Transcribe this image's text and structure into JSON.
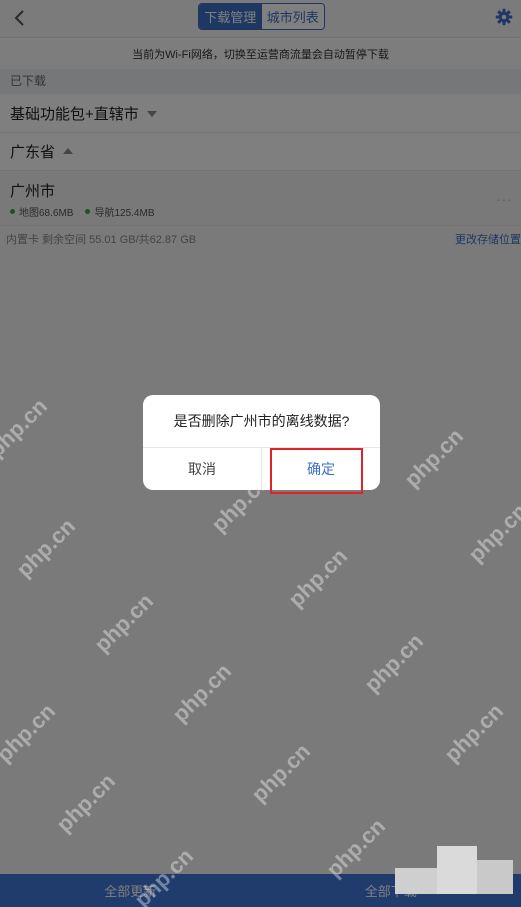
{
  "header": {
    "back_icon": "chevron-left-icon",
    "tabs": [
      {
        "label": "下载管理",
        "active": true
      },
      {
        "label": "城市列表",
        "active": false
      }
    ],
    "settings_icon": "gear-icon",
    "accent_color": "#3d6fc7"
  },
  "notice": "当前为Wi-Fi网络，切换至运营商流量会自动暂停下载",
  "downloaded_section_label": "已下载",
  "base_package": {
    "label": "基础功能包+直辖市"
  },
  "province": {
    "label": "广东省"
  },
  "city": {
    "name": "广州市",
    "map_size": "地图68.6MB",
    "nav_size": "导航125.4MB",
    "more": "···"
  },
  "storage": {
    "info": "内置卡 剩余空间 55.01 GB/共62.87 GB",
    "change_link": "更改存储位置"
  },
  "bottom_bar": {
    "update_all": "全部更新",
    "download_all": "全部下载",
    "color": "#3e78d8"
  },
  "dialog": {
    "title": "是否删除广州市的离线数据?",
    "cancel": "取消",
    "confirm": "确定"
  },
  "watermark": "php.cn"
}
